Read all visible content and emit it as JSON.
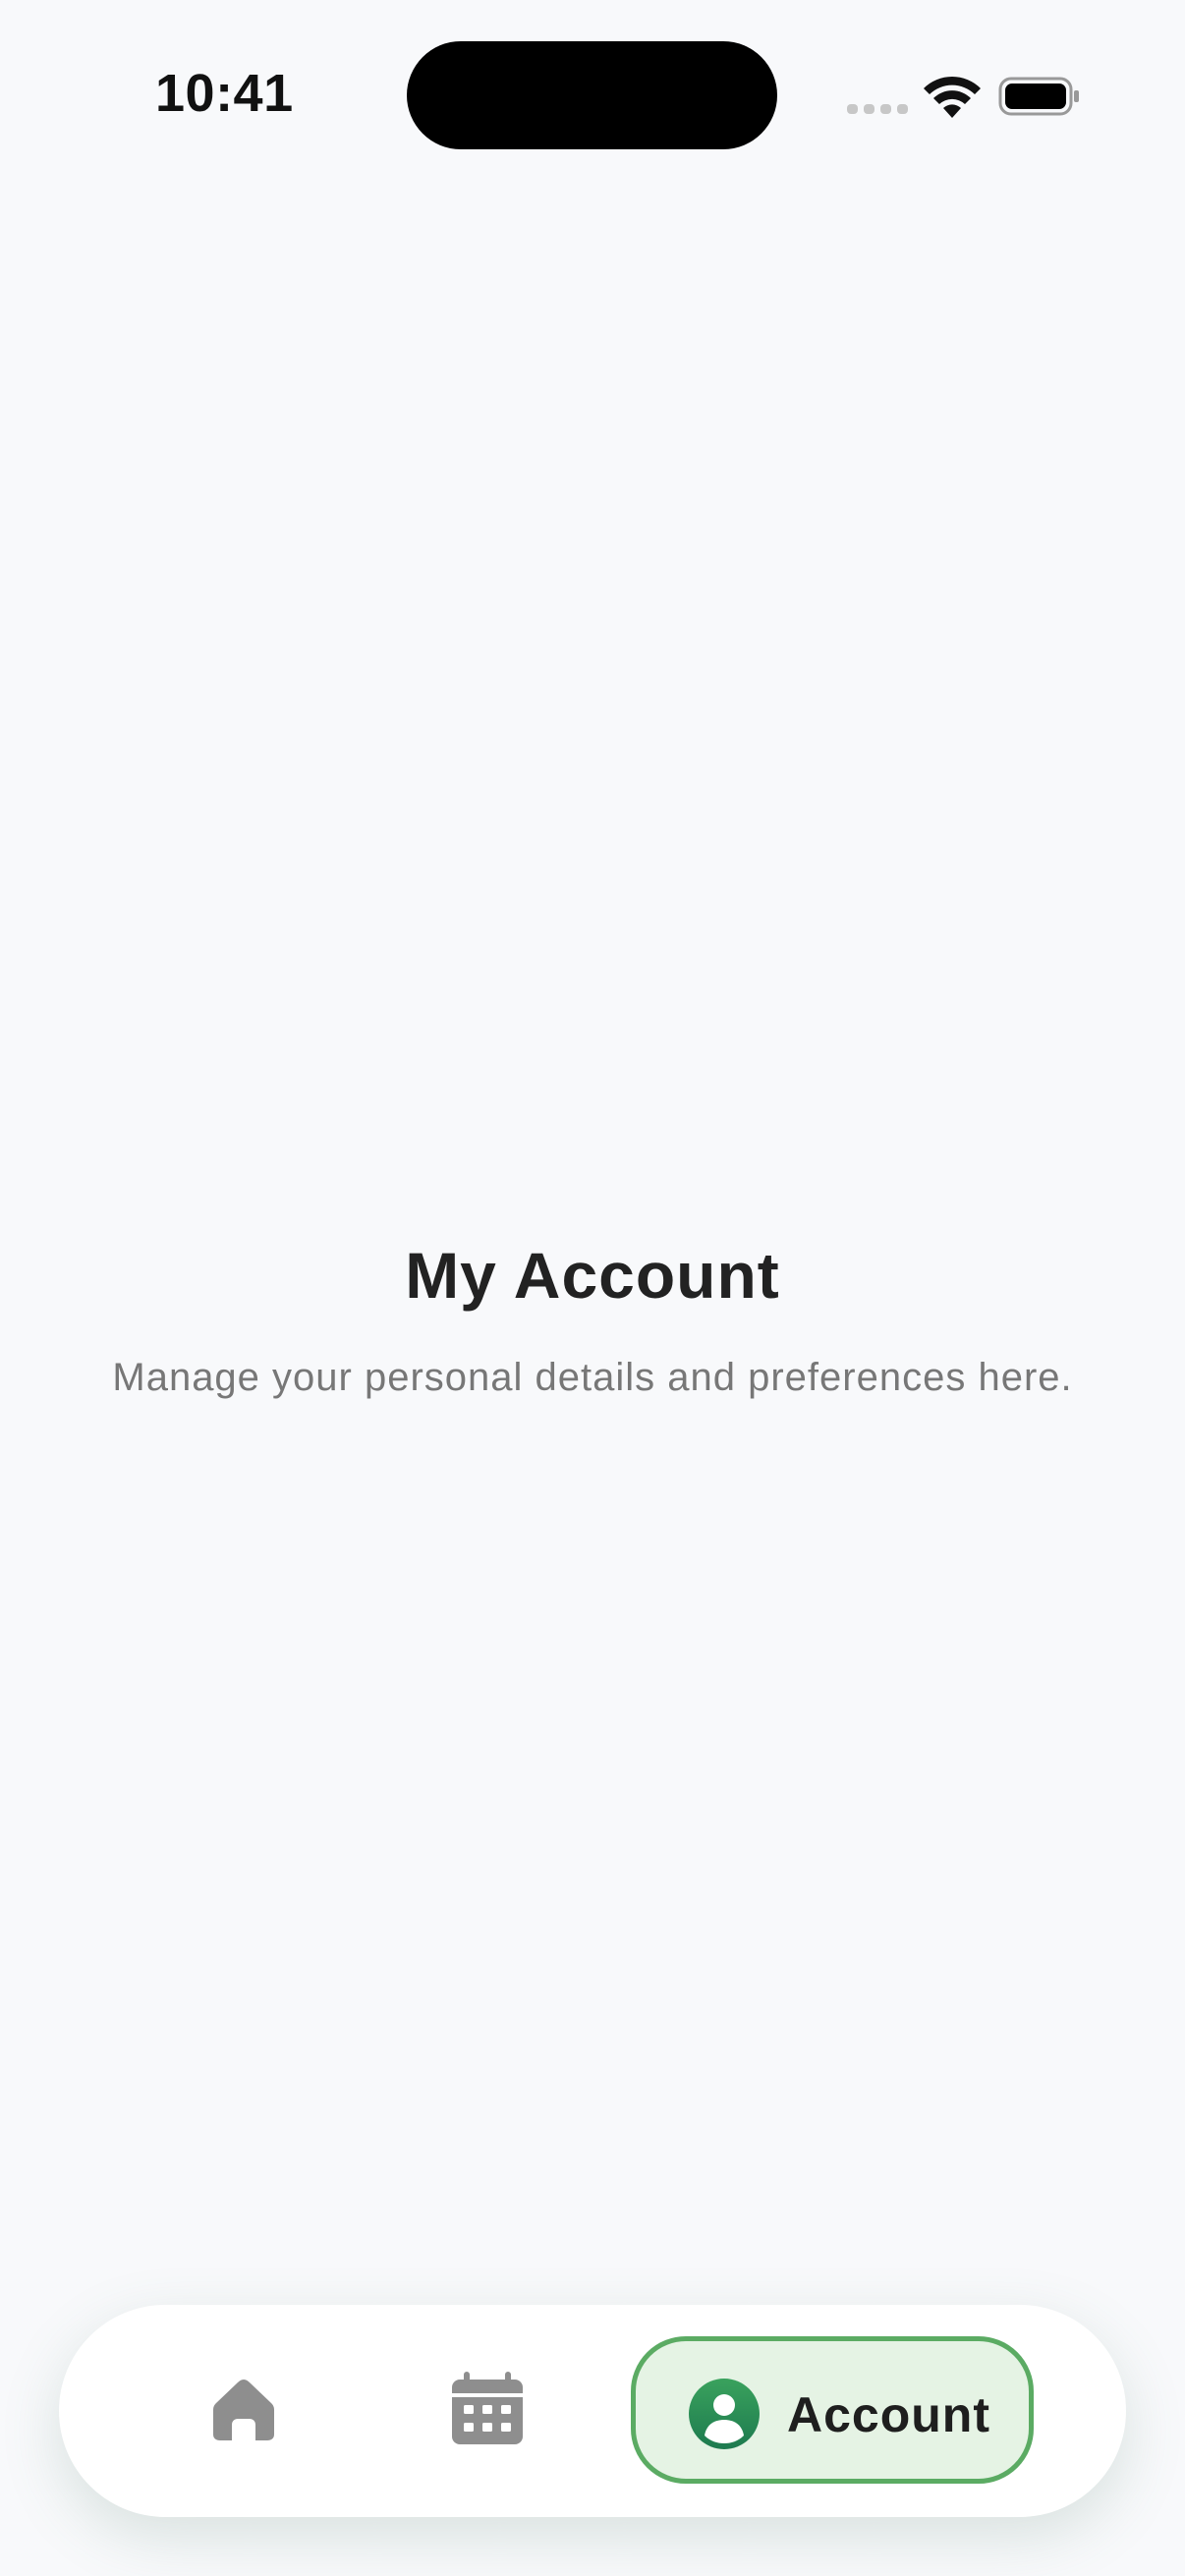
{
  "status_bar": {
    "time": "10:41",
    "icons": [
      "signal-icon",
      "wifi-icon",
      "battery-icon"
    ]
  },
  "main": {
    "title": "My Account",
    "subtitle": "Manage your personal details and preferences here."
  },
  "bottom_nav": {
    "items": [
      {
        "icon": "home-icon",
        "label": "",
        "active": false
      },
      {
        "icon": "calendar-icon",
        "label": "",
        "active": false
      },
      {
        "icon": "account-icon",
        "label": "Account",
        "active": true
      }
    ]
  },
  "colors": {
    "background": "#f8f9fb",
    "accent": "#5bab63",
    "accent_fill": "#e5f3e4",
    "inactive_icon": "#8e8e8e"
  }
}
